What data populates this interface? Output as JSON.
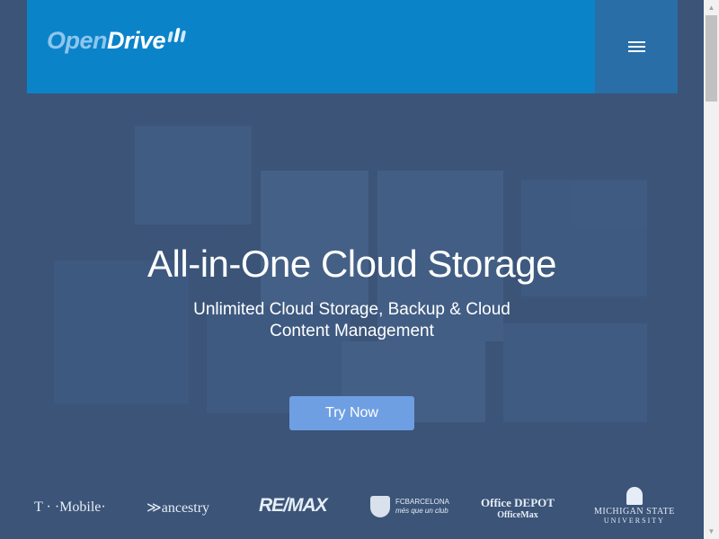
{
  "brand": {
    "logo_part1": "Open",
    "logo_part2": "Drive"
  },
  "header": {
    "menu_icon": "hamburger-menu-icon",
    "colors": {
      "bar": "#0b83c9",
      "menu_box": "#2a6ea8"
    }
  },
  "hero": {
    "title": "All-in-One Cloud Storage",
    "subtitle_line1": "Unlimited Cloud Storage, Backup & Cloud",
    "subtitle_line2": "Content Management",
    "cta_label": "Try Now",
    "cta_color": "#6f9fe3"
  },
  "clients": {
    "tmobile": "T · ·Mobile·",
    "ancestry": "ancestry",
    "remax": "RE/MAX",
    "fcb_line1": "FCBARCELONA",
    "fcb_line2": "més que un club",
    "office_line1": "Office DEPOT",
    "office_line2": "OfficeMax",
    "msu_line1": "MICHIGAN STATE",
    "msu_line2": "UNIVERSITY"
  }
}
